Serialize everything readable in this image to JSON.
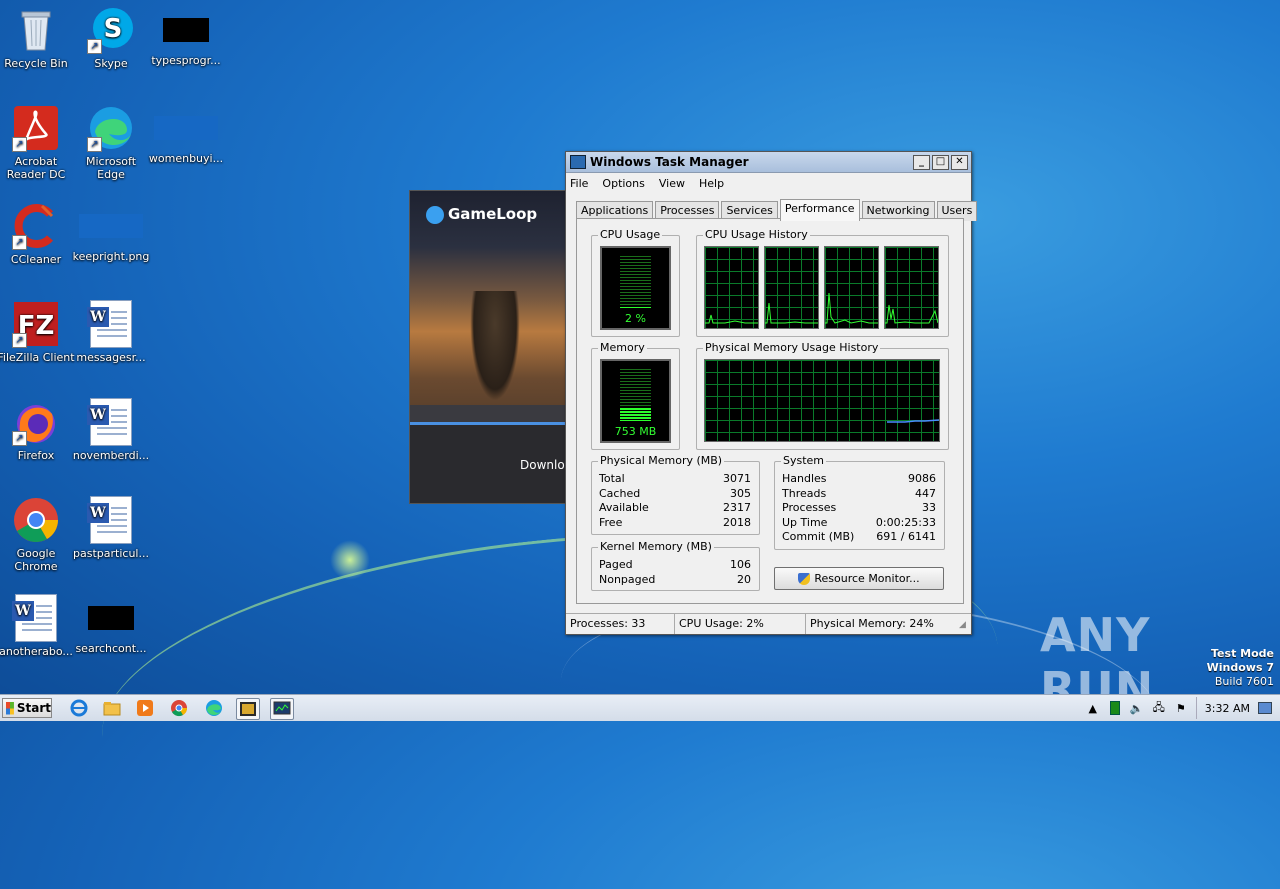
{
  "desktop": {
    "icons": [
      {
        "label": "Recycle Bin",
        "icon": "recycle-bin-icon"
      },
      {
        "label": "Skype",
        "icon": "skype-icon"
      },
      {
        "label": "typesprogr...",
        "icon": "file-icon"
      },
      {
        "label": "Acrobat Reader DC",
        "icon": "acrobat-icon"
      },
      {
        "label": "Microsoft Edge",
        "icon": "edge-icon"
      },
      {
        "label": "womenbuyi...",
        "icon": "file-icon"
      },
      {
        "label": "CCleaner",
        "icon": "ccleaner-icon"
      },
      {
        "label": "keepright.png",
        "icon": "image-icon"
      },
      {
        "label": "FileZilla Client",
        "icon": "filezilla-icon"
      },
      {
        "label": "messagesr...",
        "icon": "word-doc-icon"
      },
      {
        "label": "Firefox",
        "icon": "firefox-icon"
      },
      {
        "label": "novemberdi...",
        "icon": "word-doc-icon"
      },
      {
        "label": "Google Chrome",
        "icon": "chrome-icon"
      },
      {
        "label": "pastparticul...",
        "icon": "word-doc-icon"
      },
      {
        "label": "anotherabo...",
        "icon": "word-doc-icon"
      },
      {
        "label": "searchcont...",
        "icon": "file-icon"
      }
    ]
  },
  "gameloop": {
    "logo": "GameLoop",
    "status": "Downlo"
  },
  "taskmanager": {
    "title": "Windows Task Manager",
    "menu": [
      "File",
      "Options",
      "View",
      "Help"
    ],
    "tabs": [
      "Applications",
      "Processes",
      "Services",
      "Performance",
      "Networking",
      "Users"
    ],
    "active_tab": "Performance",
    "cpu_usage": {
      "label": "CPU Usage",
      "value": "2 %",
      "percent": 2
    },
    "cpu_history": {
      "label": "CPU Usage History"
    },
    "memory": {
      "label": "Memory",
      "value": "753 MB",
      "fill_fraction": 0.25
    },
    "phys_history": {
      "label": "Physical Memory Usage History"
    },
    "physical_memory": {
      "title": "Physical Memory (MB)",
      "rows": [
        {
          "k": "Total",
          "v": "3071"
        },
        {
          "k": "Cached",
          "v": "305"
        },
        {
          "k": "Available",
          "v": "2317"
        },
        {
          "k": "Free",
          "v": "2018"
        }
      ]
    },
    "system": {
      "title": "System",
      "rows": [
        {
          "k": "Handles",
          "v": "9086"
        },
        {
          "k": "Threads",
          "v": "447"
        },
        {
          "k": "Processes",
          "v": "33"
        },
        {
          "k": "Up Time",
          "v": "0:00:25:33"
        },
        {
          "k": "Commit (MB)",
          "v": "691 / 6141"
        }
      ]
    },
    "kernel_memory": {
      "title": "Kernel Memory (MB)",
      "rows": [
        {
          "k": "Paged",
          "v": "106"
        },
        {
          "k": "Nonpaged",
          "v": "20"
        }
      ]
    },
    "resource_button": "Resource Monitor...",
    "status": {
      "processes": "Processes: 33",
      "cpu": "CPU Usage: 2%",
      "memory": "Physical Memory: 24%"
    }
  },
  "taskbar": {
    "start": "Start",
    "clock": "3:32 AM",
    "pinned": [
      "ie-icon",
      "explorer-icon",
      "media-player-icon",
      "chrome-icon",
      "edge-icon",
      "gameloop-icon",
      "taskmanager-icon"
    ]
  },
  "watermark": {
    "text": "ANY RUN"
  },
  "testmode": {
    "line1": "Test Mode",
    "line2": "Windows 7",
    "line3": "Build 7601"
  }
}
